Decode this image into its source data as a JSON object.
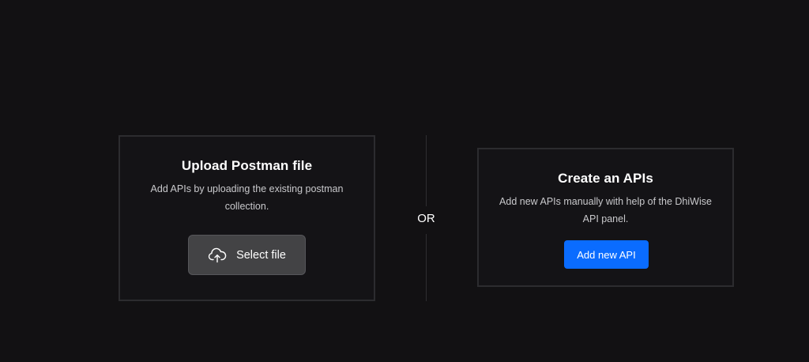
{
  "upload_card": {
    "title": "Upload Postman file",
    "description": "Add APIs by uploading the existing postman collection.",
    "button_label": "Select file",
    "button_icon": "cloud-upload-icon"
  },
  "separator": {
    "label": "OR"
  },
  "create_card": {
    "title": "Create an APIs",
    "description": "Add new APIs manually with help of the DhiWise API panel.",
    "button_label": "Add new API"
  },
  "colors": {
    "background": "#121113",
    "card_border": "#2c2c2f",
    "primary_button": "#0a6cff",
    "secondary_button": "#434345"
  }
}
